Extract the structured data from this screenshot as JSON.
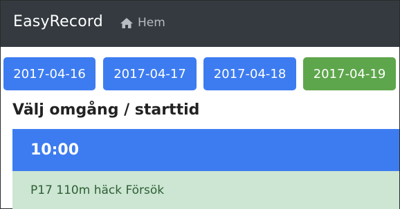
{
  "navbar": {
    "brand": "EasyRecord",
    "home_label": "Hem",
    "home_icon": "home-icon"
  },
  "dates": [
    {
      "label": "2017-04-16",
      "active": false
    },
    {
      "label": "2017-04-17",
      "active": false
    },
    {
      "label": "2017-04-18",
      "active": false
    },
    {
      "label": "2017-04-19",
      "active": true
    }
  ],
  "section_title": "Välj omgång / starttid",
  "rounds": [
    {
      "time": "10:00",
      "events": [
        "P17 110m häck Försök"
      ]
    }
  ],
  "colors": {
    "navbar_bg": "#343a40",
    "primary": "#3d7cf0",
    "success": "#5ea64c",
    "event_bg": "#cce6d3"
  }
}
